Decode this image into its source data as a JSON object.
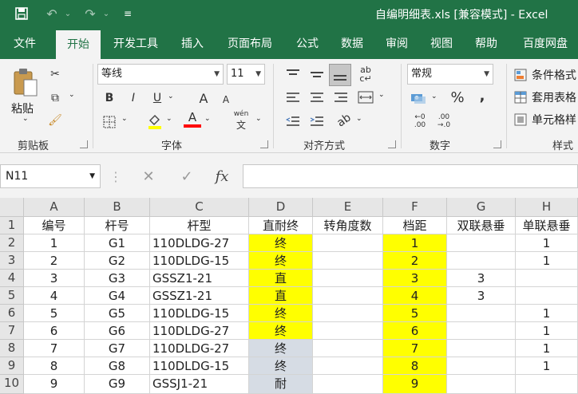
{
  "window": {
    "title": "自编明细表.xls [兼容模式] - Excel",
    "accent": "#217346"
  },
  "quick_access": [
    {
      "name": "save-icon",
      "glyph": "💾"
    },
    {
      "name": "undo-icon",
      "glyph": "↶"
    },
    {
      "name": "redo-icon",
      "glyph": "↷"
    },
    {
      "name": "customize-icon",
      "glyph": "⌄"
    }
  ],
  "tabs": [
    "文件",
    "开始",
    "开发工具",
    "插入",
    "页面布局",
    "公式",
    "数据",
    "审阅",
    "视图",
    "帮助",
    "百度网盘"
  ],
  "active_tab": "开始",
  "ribbon": {
    "clipboard": {
      "paste_label": "粘贴",
      "group_label": "剪贴板"
    },
    "font": {
      "font_name": "等线",
      "font_size": "11",
      "group_label": "字体",
      "bold": "B",
      "italic": "I",
      "underline": "U",
      "grow": "A",
      "shrink": "A",
      "font_color": "A",
      "phonetic": "wén"
    },
    "alignment": {
      "group_label": "对齐方式"
    },
    "number": {
      "format": "常规",
      "group_label": "数字",
      "percent": "%",
      "comma": ","
    },
    "styles": {
      "conditional": "条件格式",
      "table": "套用表格",
      "cell": "单元格样",
      "group_label": "样式"
    }
  },
  "formula_bar": {
    "name_box": "N11",
    "cancel": "✕",
    "enter": "✓",
    "fx": "fx",
    "content": ""
  },
  "sheet": {
    "columns": [
      "A",
      "B",
      "C",
      "D",
      "E",
      "F",
      "G",
      "H"
    ],
    "rows": [
      "1",
      "2",
      "3",
      "4",
      "5",
      "6",
      "7",
      "8",
      "9",
      "10"
    ],
    "data": [
      [
        "编号",
        "杆号",
        "杆型",
        "直耐终",
        "转角度数",
        "档距",
        "双联悬垂",
        "单联悬垂"
      ],
      [
        "1",
        "G1",
        "110DLDG-27",
        "终",
        "",
        "1",
        "",
        "1"
      ],
      [
        "2",
        "G2",
        "110DLDG-15",
        "终",
        "",
        "2",
        "",
        "1"
      ],
      [
        "3",
        "G3",
        "GSSZ1-21",
        "直",
        "",
        "3",
        "3",
        ""
      ],
      [
        "4",
        "G4",
        "GSSZ1-21",
        "直",
        "",
        "4",
        "3",
        ""
      ],
      [
        "5",
        "G5",
        "110DLDG-15",
        "终",
        "",
        "5",
        "",
        "1"
      ],
      [
        "6",
        "G6",
        "110DLDG-27",
        "终",
        "",
        "6",
        "",
        "1"
      ],
      [
        "7",
        "G7",
        "110DLDG-27",
        "终",
        "",
        "7",
        "",
        "1"
      ],
      [
        "8",
        "G8",
        "110DLDG-15",
        "终",
        "",
        "8",
        "",
        "1"
      ],
      [
        "9",
        "G9",
        "GSSJ1-21",
        "耐",
        "",
        "9",
        "",
        ""
      ]
    ],
    "fill_colors": {
      "yellow": "#ffff00",
      "gray": "#d6dce4"
    }
  }
}
